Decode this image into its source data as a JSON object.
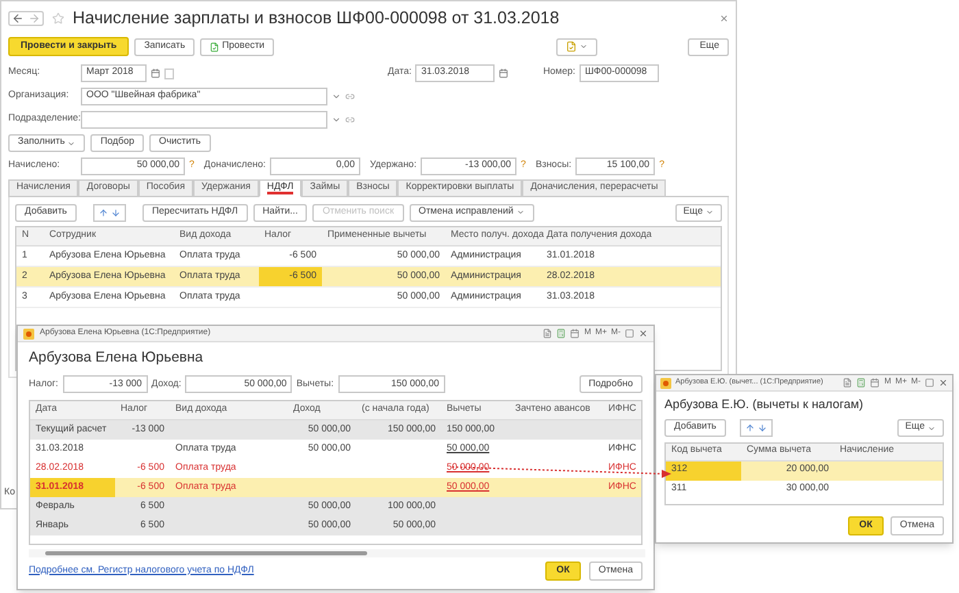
{
  "main_window": {
    "title": "Начисление зарплаты и взносов ШФ00-000098 от 31.03.2018",
    "actions": [
      {
        "label": "Провести и закрыть",
        "kind": "primary"
      },
      {
        "label": "Записать",
        "kind": "plain"
      },
      {
        "label": "Провести",
        "kind": "post"
      }
    ],
    "more": "Еще",
    "month": {
      "label": "Месяц:",
      "value": "Март 2018"
    },
    "date": {
      "label": "Дата:",
      "value": "31.03.2018"
    },
    "number": {
      "label": "Номер:",
      "value": "ШФ00-000098"
    },
    "organization": {
      "label": "Организация:",
      "value": "ООО \"Швейная фабрика\""
    },
    "subdivision": {
      "label": "Подразделение:"
    },
    "fill_buttons": [
      {
        "label": "Заполнить",
        "dropdown": true
      },
      {
        "label": "Подбор",
        "dropdown": false
      },
      {
        "label": "Очистить",
        "dropdown": false
      }
    ],
    "totals": [
      {
        "label": "Начислено:",
        "value": "50 000,00",
        "hint": "?"
      },
      {
        "label": "Доначислено:",
        "value": "0,00"
      },
      {
        "label": "Удержано:",
        "value": "-13 000,00",
        "hint": "?"
      },
      {
        "label": "Взносы:",
        "value": "15 100,00",
        "hint": "?"
      }
    ],
    "tabs": [
      {
        "label": "Начисления",
        "selected": false
      },
      {
        "label": "Договоры",
        "selected": false
      },
      {
        "label": "Пособия",
        "selected": false
      },
      {
        "label": "Удержания",
        "selected": false
      },
      {
        "label": "НДФЛ",
        "selected": true
      },
      {
        "label": "Займы",
        "selected": false
      },
      {
        "label": "Взносы",
        "selected": false
      },
      {
        "label": "Корректировки выплаты",
        "selected": false
      },
      {
        "label": "Доначисления, перерасчеты",
        "selected": false
      }
    ],
    "table_toolbar": [
      {
        "kind": "button",
        "label": "Добавить",
        "disabled": false
      },
      {
        "kind": "arrows"
      },
      {
        "kind": "button",
        "label": "Пересчитать НДФЛ",
        "disabled": false
      },
      {
        "kind": "button",
        "label": "Найти...",
        "disabled": false
      },
      {
        "kind": "button",
        "label": "Отменить поиск",
        "disabled": true
      },
      {
        "kind": "dropdown",
        "label": "Отмена исправлений",
        "disabled": false
      }
    ],
    "table_more": "Еще",
    "table": {
      "columns": [
        "N",
        "Сотрудник",
        "Вид дохода",
        "Налог",
        "Примененные вычеты",
        "Место получ. дохода",
        "Дата получения дохода"
      ],
      "rows": [
        {
          "selected": false,
          "cells": [
            "1",
            "Арбузова Елена Юрьевна",
            "Оплата труда",
            "-6 500",
            "50 000,00",
            "Администрация",
            "31.01.2018"
          ]
        },
        {
          "selected": true,
          "cells": [
            {
              "text": "2",
              "current": false
            },
            {
              "text": "Арбузова Елена Юрьевна",
              "current": false
            },
            {
              "text": "Оплата труда",
              "current": false
            },
            {
              "text": "-6 500",
              "current": true
            },
            {
              "text": "50 000,00",
              "current": false
            },
            {
              "text": "Администрация",
              "current": false
            },
            {
              "text": "28.02.2018",
              "current": false
            }
          ]
        },
        {
          "selected": false,
          "cells": [
            "3",
            "Арбузова Елена Юрьевна",
            "Оплата труда",
            null,
            "50 000,00",
            "Администрация",
            "31.03.2018"
          ]
        }
      ]
    },
    "footer_text": "Ко"
  },
  "detail_window": {
    "window_title": "Арбузова Елена Юрьевна (1С:Предприятие)",
    "title_tools": [
      "M",
      "M+",
      "M-"
    ],
    "heading": "Арбузова Елена Юрьевна",
    "summary": [
      {
        "label": "Налог:",
        "value": "-13 000"
      },
      {
        "label": "Доход:",
        "value": "50 000,00"
      },
      {
        "label": "Вычеты:",
        "value": "150 000,00"
      }
    ],
    "details_button": "Подробно",
    "table": {
      "columns": [
        "Дата",
        "Налог",
        "Вид дохода",
        "Доход",
        "(с начала года)",
        "Вычеты",
        "Зачтено авансов",
        "ИФНС"
      ],
      "rows": [
        {
          "kind": "summary",
          "storno": false,
          "selected": false,
          "cells": [
            "Текущий расчет",
            "-13 000",
            null,
            "50 000,00",
            "150 000,00",
            "150 000,00",
            null,
            null
          ]
        },
        {
          "kind": "entry",
          "storno": false,
          "selected": false,
          "cells": [
            "31.03.2018",
            null,
            "Оплата труда",
            "50 000,00",
            null,
            {
              "text": "50 000,00",
              "link": true
            },
            null,
            "ИФНС"
          ]
        },
        {
          "kind": "entry",
          "storno": true,
          "selected": false,
          "cells": [
            "28.02.2018",
            "-6 500",
            "Оплата труда",
            null,
            null,
            {
              "text": "50 000,00",
              "link": true
            },
            null,
            "ИФНС"
          ]
        },
        {
          "kind": "entry",
          "storno": true,
          "selected": true,
          "cells": [
            {
              "text": "31.01.2018",
              "current": true
            },
            {
              "text": "-6 500",
              "current": false
            },
            {
              "text": "Оплата труда",
              "current": false
            },
            null,
            null,
            {
              "text": "50 000,00",
              "link": true,
              "current": false
            },
            null,
            {
              "text": "ИФНС",
              "current": false
            }
          ]
        },
        {
          "kind": "summary",
          "storno": false,
          "selected": false,
          "cells": [
            "Февраль",
            "6 500",
            null,
            "50 000,00",
            "100 000,00",
            null,
            null,
            null
          ]
        },
        {
          "kind": "summary",
          "storno": false,
          "selected": false,
          "cells": [
            "Январь",
            "6 500",
            null,
            "50 000,00",
            "50 000,00",
            null,
            null,
            null
          ]
        }
      ]
    },
    "link": "Подробнее см. Регистр налогового учета по НДФЛ",
    "ok": "ОК",
    "cancel": "Отмена"
  },
  "deductions_window": {
    "window_title": "Арбузова Е.Ю. (вычет... (1С:Предприятие)",
    "title_tools": [
      "M",
      "M+",
      "M-"
    ],
    "heading": "Арбузова Е.Ю. (вычеты к налогам)",
    "add": "Добавить",
    "more": "Еще",
    "table": {
      "columns": [
        "Код вычета",
        "Сумма вычета",
        "Начисление"
      ],
      "rows": [
        {
          "selected": true,
          "cells": [
            {
              "text": "312",
              "current": true
            },
            {
              "text": "20 000,00",
              "current": false
            },
            null
          ]
        },
        {
          "selected": false,
          "cells": [
            "311",
            "30 000,00",
            null
          ]
        }
      ]
    },
    "ok": "ОК",
    "cancel": "Отмена"
  }
}
